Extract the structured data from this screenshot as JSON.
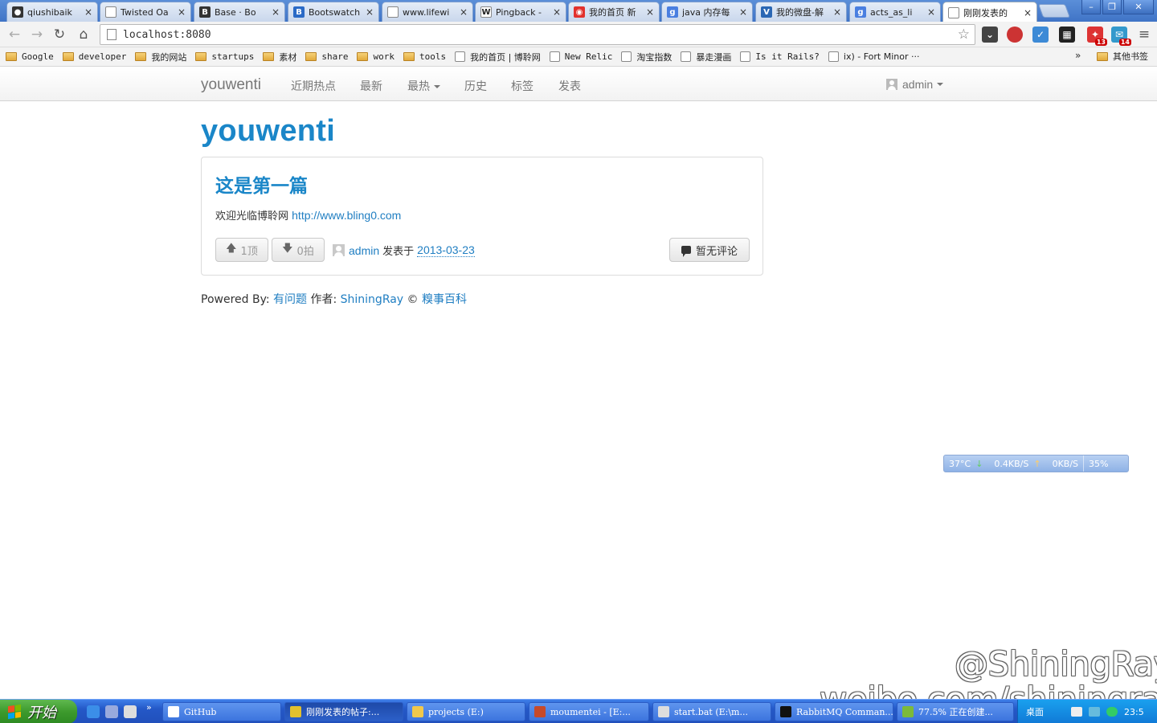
{
  "browser": {
    "tabs": [
      {
        "title": "qiushibaik",
        "icon": "github-icon",
        "color": "#333333",
        "glyph": "●"
      },
      {
        "title": "Twisted Oa",
        "icon": "page-icon",
        "color": "#ffffff",
        "glyph": ""
      },
      {
        "title": "Base · Bo",
        "icon": "bootstrap-b-icon",
        "color": "#333333",
        "glyph": "B"
      },
      {
        "title": "Bootswatch",
        "icon": "bootswatch-b-icon",
        "color": "#2a6ac6",
        "glyph": "B"
      },
      {
        "title": "www.lifewi",
        "icon": "page-icon",
        "color": "#ffffff",
        "glyph": ""
      },
      {
        "title": "Pingback -",
        "icon": "wikipedia-w-icon",
        "color": "#ffffff",
        "glyph": "W"
      },
      {
        "title": "我的首页 新",
        "icon": "weibo-icon",
        "color": "#e2312d",
        "glyph": "◉"
      },
      {
        "title": "java 内存每",
        "icon": "google-g-icon",
        "color": "#4a7fe0",
        "glyph": "g"
      },
      {
        "title": "我的微盘-解",
        "icon": "vdisk-icon",
        "color": "#2a67b4",
        "glyph": "V"
      },
      {
        "title": "acts_as_li",
        "icon": "google-g-icon",
        "color": "#4a7fe0",
        "glyph": "g"
      },
      {
        "title": "刚刚发表的",
        "icon": "page-icon",
        "color": "#ffffff",
        "glyph": ""
      }
    ],
    "url": "localhost:8080",
    "bookmarks": [
      {
        "label": "Google",
        "type": "folder"
      },
      {
        "label": "developer",
        "type": "folder"
      },
      {
        "label": "我的网站",
        "type": "folder"
      },
      {
        "label": "startups",
        "type": "folder"
      },
      {
        "label": "素材",
        "type": "folder"
      },
      {
        "label": "share",
        "type": "folder"
      },
      {
        "label": "work",
        "type": "folder"
      },
      {
        "label": "tools",
        "type": "folder"
      },
      {
        "label": "我的首页 | 博聆网",
        "type": "bookmark"
      },
      {
        "label": "New Relic",
        "type": "bookmark"
      },
      {
        "label": "淘宝指数",
        "type": "bookmark"
      },
      {
        "label": "暴走漫画",
        "type": "bookmark"
      },
      {
        "label": "Is it Rails?",
        "type": "bookmark"
      },
      {
        "label": "ix) - Fort Minor ···",
        "type": "bookmark"
      }
    ],
    "bookmarks_more": "»",
    "other_bookmarks": "其他书签",
    "ext_badges": {
      "first": "13",
      "second": "14"
    }
  },
  "site": {
    "brand": "youwenti",
    "nav": {
      "recent_hot": "近期热点",
      "latest": "最新",
      "hottest": "最热",
      "history": "历史",
      "tags": "标签",
      "publish": "发表"
    },
    "user": "admin",
    "page_title": "youwenti",
    "post": {
      "title": "这是第一篇",
      "body_text": "欢迎光临博聆网 ",
      "body_link": "http://www.bling0.com",
      "up_label": "1顶",
      "down_label": "0拍",
      "author": "admin",
      "posted_on": "发表于",
      "date": "2013-03-23",
      "comments_label": "暂无评论"
    },
    "footer": {
      "powered_by": "Powered By: ",
      "project": "有问题",
      "author_label": " 作者: ",
      "author": "ShiningRay",
      "copyright": " © ",
      "company": "糗事百科"
    }
  },
  "desktop": {
    "widget": {
      "temp": "37°C",
      "down": "0.4KB/S",
      "up": "0KB/S",
      "cpu": "35%"
    },
    "watermark": {
      "line1": "@ShiningRay",
      "line2": "weibo.com/shiningray"
    }
  },
  "taskbar": {
    "start": "开始",
    "quicklaunch_more": "»",
    "tasks": [
      {
        "label": "GitHub",
        "color": "#ffffff"
      },
      {
        "label": "刚刚发表的帖子:...",
        "color": "#e2c02d"
      },
      {
        "label": "projects (E:)",
        "color": "#f1c84b"
      },
      {
        "label": "moumentei - [E:...",
        "color": "#c74a2a"
      },
      {
        "label": "start.bat (E:\\m...",
        "color": "#dddddd"
      },
      {
        "label": "RabbitMQ Comman...",
        "color": "#111111"
      },
      {
        "label": "77.5% 正在创建...",
        "color": "#7cba3a"
      }
    ],
    "tray_text": "桌面",
    "clock": "23:5"
  }
}
